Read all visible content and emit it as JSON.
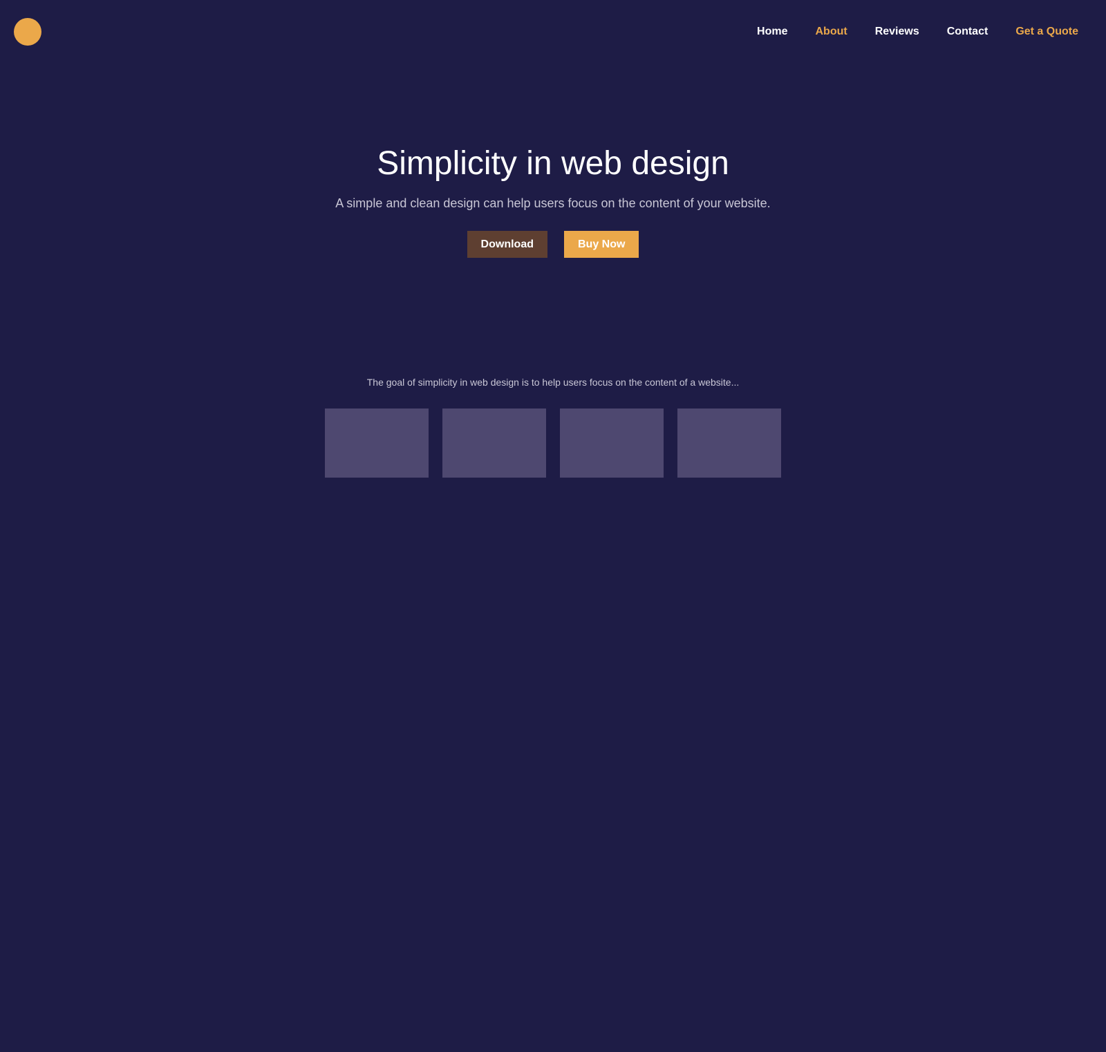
{
  "colors": {
    "background": "#1e1c46",
    "accent": "#eba84a",
    "download_button": "#5e3f31",
    "card": "#4e4870"
  },
  "header": {
    "logo_icon": "circle-logo-icon",
    "nav": [
      {
        "label": "Home",
        "accent": false
      },
      {
        "label": "About",
        "accent": true
      },
      {
        "label": "Reviews",
        "accent": false
      },
      {
        "label": "Contact",
        "accent": false
      },
      {
        "label": "Get a Quote",
        "accent": true
      }
    ]
  },
  "hero": {
    "title": "Simplicity in web design",
    "subtitle": "A simple and clean design can help users focus on the content of your website.",
    "download_label": "Download",
    "buy_label": "Buy Now"
  },
  "content": {
    "goal_text": "The goal of simplicity in web design is to help users focus on the content of a website...",
    "cards": [
      {},
      {},
      {},
      {}
    ]
  }
}
